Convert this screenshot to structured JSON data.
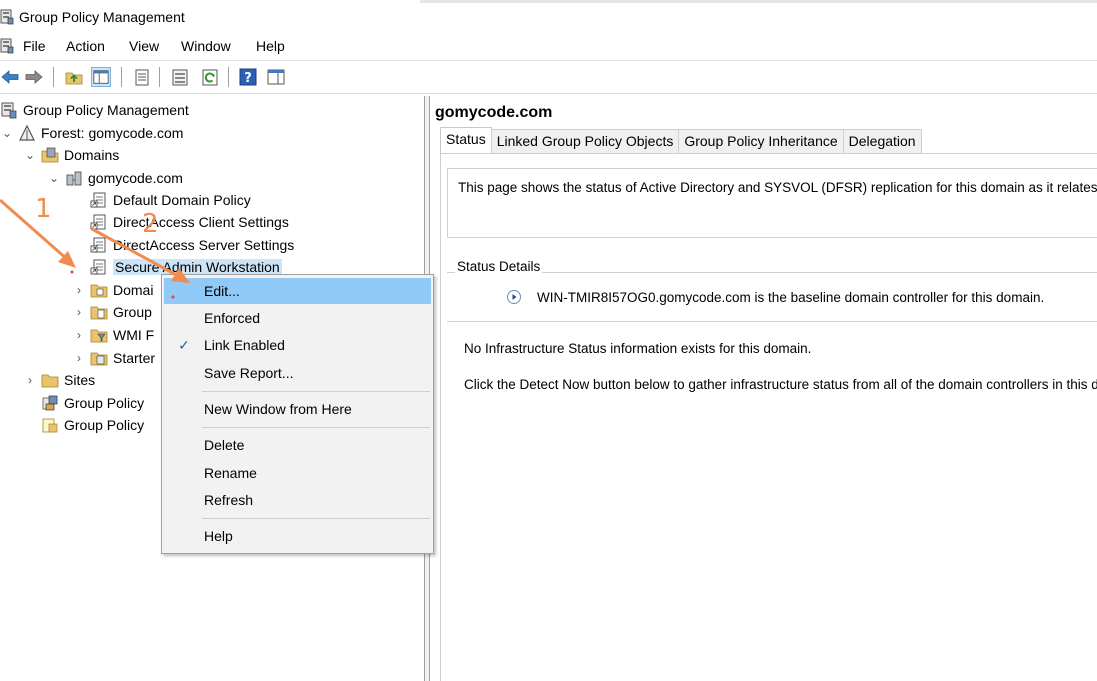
{
  "window": {
    "title": "Group Policy Management"
  },
  "menubar": {
    "items": [
      "File",
      "Action",
      "View",
      "Window",
      "Help"
    ]
  },
  "tree": {
    "root": "Group Policy Management",
    "forest": "Forest: gomycode.com",
    "domains": "Domains",
    "domain": "gomycode.com",
    "gpo_links": [
      "Default Domain Policy",
      "DirectAccess Client Settings",
      "DirectAccess Server Settings",
      "Secure Admin Workstation"
    ],
    "domain_children": [
      "Domai",
      "Group",
      "WMI F",
      "Starter"
    ],
    "sites": "Sites",
    "bottom_items": [
      "Group Policy",
      "Group Policy"
    ]
  },
  "right": {
    "title": "gomycode.com",
    "tabs": [
      "Status",
      "Linked Group Policy Objects",
      "Group Policy Inheritance",
      "Delegation"
    ],
    "description": "This page shows the status of Active Directory and SYSVOL (DFSR) replication for this domain as it relates to",
    "status_details_label": "Status Details",
    "baseline_text": "WIN-TMIR8I57OG0.gomycode.com is the baseline domain controller for this domain.",
    "info1": "No Infrastructure Status information exists for this domain.",
    "info2": "Click the Detect Now button below to gather infrastructure status from all of the domain controllers in this dor"
  },
  "context_menu": {
    "edit": "Edit...",
    "enforced": "Enforced",
    "link_enabled": "Link Enabled",
    "save_report": "Save Report...",
    "new_window": "New Window from Here",
    "delete": "Delete",
    "rename": "Rename",
    "refresh": "Refresh",
    "help": "Help"
  },
  "annotations": {
    "step1": "1",
    "step2": "2"
  },
  "colors": {
    "annotation": "#f28b4e",
    "menu_hover": "#91c9f7",
    "selection": "#cce4f7"
  }
}
